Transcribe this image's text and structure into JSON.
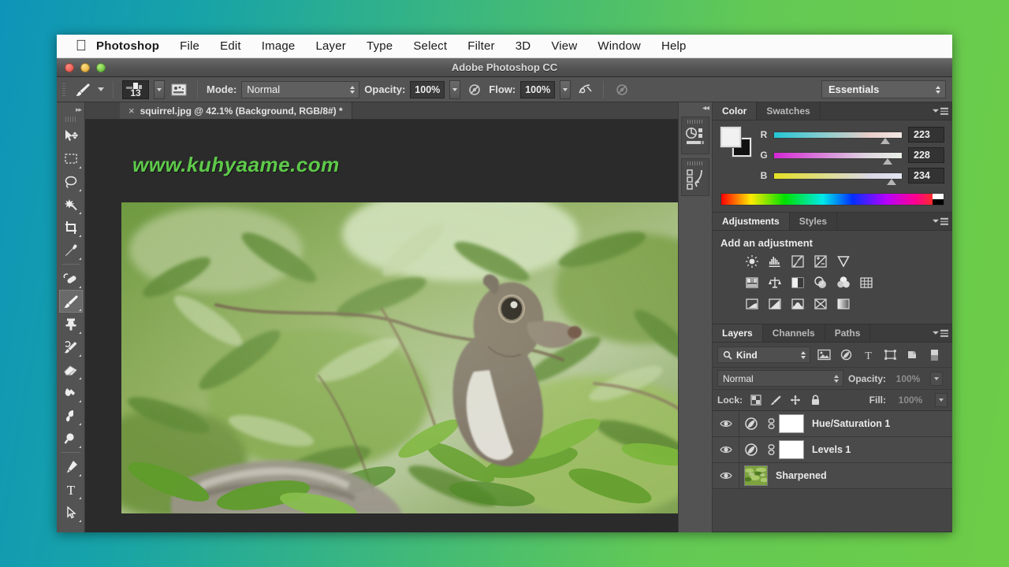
{
  "app": {
    "window_title": "Adobe Photoshop CC",
    "apple_icon": "apple-logo-icon"
  },
  "menubar": {
    "items": [
      {
        "label": "Photoshop",
        "bold": true
      },
      {
        "label": "File"
      },
      {
        "label": "Edit"
      },
      {
        "label": "Image"
      },
      {
        "label": "Layer"
      },
      {
        "label": "Type"
      },
      {
        "label": "Select"
      },
      {
        "label": "Filter"
      },
      {
        "label": "3D"
      },
      {
        "label": "View"
      },
      {
        "label": "Window"
      },
      {
        "label": "Help"
      }
    ]
  },
  "options_bar": {
    "tool_icon": "brush-tool-icon",
    "brush_size": "13",
    "brush_preset_icon": "brush-preset-picker-icon",
    "mode_label": "Mode:",
    "mode_value": "Normal",
    "opacity_label": "Opacity:",
    "opacity_value": "100%",
    "airbrush_icon": "airbrush-icon",
    "flow_label": "Flow:",
    "flow_value": "100%",
    "tablet_pressure_size_icon": "tablet-pressure-size-icon",
    "tablet_pressure_opacity_icon": "tablet-pressure-opacity-icon",
    "workspace_value": "Essentials"
  },
  "toolbar": {
    "tools": [
      {
        "name": "move-tool",
        "label": "Move Tool",
        "selected": false
      },
      {
        "name": "rectangular-marquee-tool",
        "label": "Rectangular Marquee Tool",
        "selected": false
      },
      {
        "name": "lasso-tool",
        "label": "Lasso Tool",
        "selected": false
      },
      {
        "name": "magic-wand-tool",
        "label": "Quick Selection / Magic Wand Tool",
        "selected": false
      },
      {
        "name": "crop-tool",
        "label": "Crop Tool",
        "selected": false
      },
      {
        "name": "eyedropper-tool",
        "label": "Eyedropper Tool",
        "selected": false
      },
      {
        "name": "spot-healing-brush-tool",
        "label": "Spot Healing Brush Tool",
        "selected": false
      },
      {
        "name": "brush-tool",
        "label": "Brush Tool",
        "selected": true
      },
      {
        "name": "clone-stamp-tool",
        "label": "Clone Stamp Tool",
        "selected": false
      },
      {
        "name": "history-brush-tool",
        "label": "History Brush Tool",
        "selected": false
      },
      {
        "name": "eraser-tool",
        "label": "Eraser Tool",
        "selected": false
      },
      {
        "name": "gradient-tool",
        "label": "Gradient / Paint Bucket Tool",
        "selected": false
      },
      {
        "name": "dodge-tool",
        "label": "Dodge / Burn Tool",
        "selected": false
      },
      {
        "name": "zoom-tool",
        "label": "Zoom Tool",
        "selected": false
      },
      {
        "name": "pen-tool",
        "label": "Pen Tool",
        "selected": false
      },
      {
        "name": "type-tool",
        "label": "Horizontal Type Tool",
        "selected": false
      },
      {
        "name": "path-selection-tool",
        "label": "Path Selection Tool",
        "selected": false
      }
    ]
  },
  "document": {
    "tab_title": "squirrel.jpg @ 42.1% (Background, RGB/8#) *",
    "close_glyph": "×",
    "watermark": "www.kuhyaame.com",
    "watermark_color": "#5ec94a",
    "image_subject": "grey squirrel in green leafy tree branches"
  },
  "color_panel": {
    "tabs": [
      {
        "label": "Color",
        "active": true
      },
      {
        "label": "Swatches",
        "active": false
      }
    ],
    "foreground_color": "#f1f1f1",
    "background_color": "#111111",
    "channels": [
      {
        "label": "R",
        "value": "223",
        "pos_pct": 87
      },
      {
        "label": "G",
        "value": "228",
        "pos_pct": 89
      },
      {
        "label": "B",
        "value": "234",
        "pos_pct": 92
      }
    ]
  },
  "adjustments_panel": {
    "tabs": [
      {
        "label": "Adjustments",
        "active": true
      },
      {
        "label": "Styles",
        "active": false
      }
    ],
    "heading": "Add an adjustment",
    "rows": [
      [
        "brightness-contrast-icon",
        "levels-icon",
        "curves-icon",
        "exposure-icon",
        "vibrance-icon"
      ],
      [
        "hue-saturation-icon",
        "color-balance-icon",
        "black-white-icon",
        "photo-filter-icon",
        "channel-mixer-icon",
        "color-lookup-icon"
      ],
      [
        "invert-icon",
        "posterize-icon",
        "threshold-icon",
        "selective-color-icon",
        "gradient-map-icon"
      ]
    ]
  },
  "layers_panel": {
    "tabs": [
      {
        "label": "Layers",
        "active": true
      },
      {
        "label": "Channels",
        "active": false
      },
      {
        "label": "Paths",
        "active": false
      }
    ],
    "filter_label": "Kind",
    "filter_icons": [
      "filter-pixel-icon",
      "filter-adjustment-icon",
      "filter-type-icon",
      "filter-shape-icon",
      "filter-smart-object-icon"
    ],
    "blend_mode": "Normal",
    "opacity_label": "Opacity:",
    "opacity_value": "100%",
    "lock_label": "Lock:",
    "lock_icons": [
      "lock-transparency-icon",
      "lock-image-icon",
      "lock-position-icon",
      "lock-all-icon"
    ],
    "fill_label": "Fill:",
    "fill_value": "100%",
    "layers": [
      {
        "name": "Hue/Saturation 1",
        "type": "adjustment",
        "visible": true,
        "linked": true
      },
      {
        "name": "Levels 1",
        "type": "adjustment",
        "visible": true,
        "linked": true
      },
      {
        "name": "Sharpened",
        "type": "pixel",
        "visible": true,
        "linked": false
      }
    ]
  },
  "dock": {
    "collapse_glyph": "◂◂",
    "mini_panels": [
      "histogram-panel-icon",
      "history-panel-icon"
    ]
  },
  "desktop": {
    "gradient_from": "#0e94b8",
    "gradient_to": "#6ecd47"
  }
}
